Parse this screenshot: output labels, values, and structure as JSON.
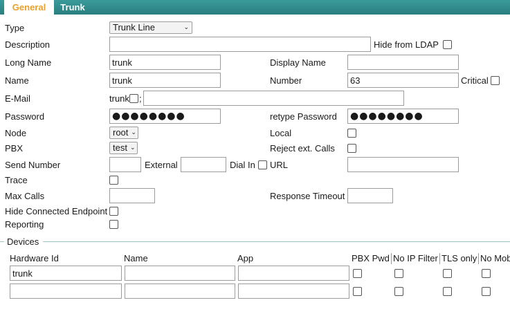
{
  "tabs": {
    "general": "General",
    "trunk": "Trunk"
  },
  "labels": {
    "type": "Type",
    "description": "Description",
    "hide_ldap": "Hide from LDAP",
    "long_name": "Long Name",
    "display_name": "Display Name",
    "name": "Name",
    "number": "Number",
    "critical": "Critical",
    "email": "E-Mail",
    "email_prefix": "trunk",
    "email_sep": ";",
    "password": "Password",
    "retype_password": "retype Password",
    "node": "Node",
    "local": "Local",
    "pbx": "PBX",
    "reject_ext_calls": "Reject ext. Calls",
    "send_number": "Send Number",
    "external": "External",
    "dial_in": "Dial In",
    "url": "URL",
    "trace": "Trace",
    "max_calls": "Max Calls",
    "response_timeout": "Response Timeout",
    "hide_connected_endpoint": "Hide Connected Endpoint",
    "reporting": "Reporting",
    "devices": "Devices"
  },
  "values": {
    "type": "Trunk Line",
    "description": "",
    "long_name": "trunk",
    "display_name": "",
    "name": "trunk",
    "number": "63",
    "email": "",
    "password": "●●●●●●●●",
    "retype_password": "●●●●●●●●",
    "node": "root",
    "pbx": "test",
    "send_number": "",
    "external": "",
    "url": "",
    "max_calls": "",
    "response_timeout": ""
  },
  "devices": {
    "columns": [
      "Hardware Id",
      "Name",
      "App",
      "PBX Pwd",
      "No IP Filter",
      "TLS only",
      "No Mob"
    ],
    "rows": [
      {
        "hardware_id": "trunk",
        "name": "",
        "app": ""
      },
      {
        "hardware_id": "",
        "name": "",
        "app": ""
      }
    ]
  },
  "colors": {
    "tab_bar": "#2a8a8a",
    "active_tab_text": "#e8a12a"
  }
}
